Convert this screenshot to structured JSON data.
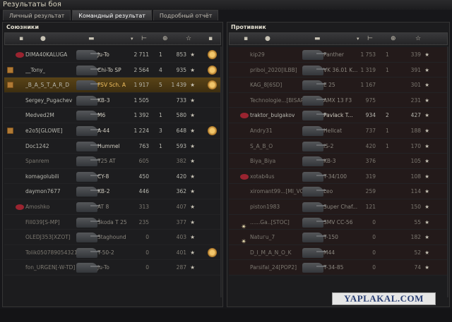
{
  "window_title": "Результаты боя",
  "tabs": [
    {
      "label": "Личный результат",
      "active": false
    },
    {
      "label": "Командный результат",
      "active": true
    },
    {
      "label": "Подробный отчёт",
      "active": false
    }
  ],
  "allies": {
    "title": "Союзники",
    "rows": [
      {
        "name": "DIMA40KALUGA",
        "vehicle": "Ju-To",
        "damage": "2 711",
        "kills": "1",
        "xp": "853",
        "badge": false,
        "clan": "red",
        "medal": true,
        "state": "alive"
      },
      {
        "name": "__Tony_",
        "vehicle": "Chi-To SP",
        "damage": "2 564",
        "kills": "4",
        "xp": "935",
        "badge": true,
        "clan": "",
        "medal": true,
        "state": "alive"
      },
      {
        "name": "_B_A_S_T_A_R_D",
        "vehicle": "FSV Sch. A",
        "damage": "1 917",
        "kills": "5",
        "xp": "1 439",
        "badge": true,
        "clan": "",
        "medal": true,
        "state": "self"
      },
      {
        "name": "Sergey_Pugachev",
        "vehicle": "KB-3",
        "damage": "1 505",
        "kills": "",
        "xp": "733",
        "badge": false,
        "clan": "",
        "medal": false,
        "state": "alive"
      },
      {
        "name": "Medved2M",
        "vehicle": "M6",
        "damage": "1 392",
        "kills": "1",
        "xp": "580",
        "badge": false,
        "clan": "",
        "medal": false,
        "state": "alive"
      },
      {
        "name": "e2o5[GLOWE]",
        "vehicle": "A-44",
        "damage": "1 224",
        "kills": "3",
        "xp": "648",
        "badge": true,
        "clan": "",
        "medal": true,
        "state": "alive"
      },
      {
        "name": "Doc1242",
        "vehicle": "Hummel",
        "damage": "763",
        "kills": "1",
        "xp": "593",
        "badge": false,
        "clan": "",
        "medal": false,
        "state": "alive"
      },
      {
        "name": "Spanrem",
        "vehicle": "T25 AT",
        "damage": "605",
        "kills": "",
        "xp": "382",
        "badge": false,
        "clan": "",
        "medal": false,
        "state": "dead"
      },
      {
        "name": "komagolubili",
        "vehicle": "CY-8",
        "damage": "450",
        "kills": "",
        "xp": "420",
        "badge": false,
        "clan": "",
        "medal": false,
        "state": "alive"
      },
      {
        "name": "daymon7677",
        "vehicle": "KB-2",
        "damage": "446",
        "kills": "",
        "xp": "362",
        "badge": false,
        "clan": "",
        "medal": false,
        "state": "alive"
      },
      {
        "name": "Amoshko",
        "vehicle": "AT 8",
        "damage": "313",
        "kills": "",
        "xp": "407",
        "badge": false,
        "clan": "red",
        "medal": false,
        "state": "dead"
      },
      {
        "name": "Fill039[S-MP]",
        "vehicle": "Škoda T 25",
        "damage": "235",
        "kills": "",
        "xp": "377",
        "badge": false,
        "clan": "",
        "medal": false,
        "state": "dead"
      },
      {
        "name": "OLEDJ353[XZOT]",
        "vehicle": "Staghound",
        "damage": "0",
        "kills": "",
        "xp": "403",
        "badge": false,
        "clan": "",
        "medal": false,
        "state": "dead"
      },
      {
        "name": "Tolik050789054321...",
        "vehicle": "T-50-2",
        "damage": "0",
        "kills": "",
        "xp": "401",
        "badge": false,
        "clan": "",
        "medal": true,
        "state": "dead"
      },
      {
        "name": "fon_URGEN[-W-TD]",
        "vehicle": "Ju-To",
        "damage": "0",
        "kills": "",
        "xp": "287",
        "badge": false,
        "clan": "",
        "medal": false,
        "state": "dead"
      }
    ]
  },
  "enemies": {
    "title": "Противник",
    "rows": [
      {
        "name": "kip29",
        "vehicle": "Panther",
        "damage": "1 753",
        "kills": "1",
        "xp": "339",
        "clan": "",
        "state": "dead"
      },
      {
        "name": "priboi_2020[ILBB]",
        "vehicle": "VK 36.01 K...",
        "damage": "1 319",
        "kills": "1",
        "xp": "391",
        "clan": "",
        "state": "dead"
      },
      {
        "name": "KAG_8[6SD]",
        "vehicle": "E 25",
        "damage": "1 167",
        "kills": "",
        "xp": "301",
        "clan": "",
        "state": "dead"
      },
      {
        "name": "Technologie...[BISAR]",
        "vehicle": "AMX 13 F3",
        "damage": "975",
        "kills": "",
        "xp": "231",
        "clan": "",
        "state": "dead"
      },
      {
        "name": "traktor_bulgakov",
        "vehicle": "Pavlack T...",
        "damage": "934",
        "kills": "2",
        "xp": "427",
        "clan": "red",
        "state": "alive"
      },
      {
        "name": "Andry31",
        "vehicle": "Hellcat",
        "damage": "737",
        "kills": "1",
        "xp": "188",
        "clan": "",
        "state": "dead"
      },
      {
        "name": "S_A_B_O",
        "vehicle": "IS-2",
        "damage": "420",
        "kills": "1",
        "xp": "170",
        "clan": "",
        "state": "dead"
      },
      {
        "name": "Biya_Biya",
        "vehicle": "KB-3",
        "damage": "376",
        "kills": "",
        "xp": "105",
        "clan": "",
        "state": "dead"
      },
      {
        "name": "xotab4us",
        "vehicle": "T-34/100",
        "damage": "319",
        "kills": "",
        "xp": "108",
        "clan": "red",
        "state": "dead"
      },
      {
        "name": "xiromant99...[MI_VO]",
        "vehicle": "Leo",
        "damage": "259",
        "kills": "",
        "xp": "114",
        "clan": "",
        "state": "dead"
      },
      {
        "name": "piston1983",
        "vehicle": "Super Chaf...",
        "damage": "121",
        "kills": "",
        "xp": "150",
        "clan": "",
        "state": "dead"
      },
      {
        "name": "......Ga..[STOC]",
        "vehicle": "SMV CC-56",
        "damage": "0",
        "kills": "",
        "xp": "55",
        "clan": "star",
        "state": "dead"
      },
      {
        "name": "Natuгu_7",
        "vehicle": "T-150",
        "damage": "0",
        "kills": "",
        "xp": "182",
        "clan": "star",
        "state": "dead"
      },
      {
        "name": "D_I_M_A_N_O_K",
        "vehicle": "M44",
        "damage": "0",
        "kills": "",
        "xp": "52",
        "clan": "",
        "state": "dead"
      },
      {
        "name": "Parsifal_24[POP2]",
        "vehicle": "T-34-85",
        "damage": "0",
        "kills": "",
        "xp": "74",
        "clan": "",
        "state": "dead"
      }
    ]
  },
  "star_glyph": "★",
  "watermark": "YAPLAKAL.COM",
  "colors": {
    "self_row": "#5a4417",
    "enemy_row": "#231a1a",
    "highlight_name": "#f2c060"
  }
}
